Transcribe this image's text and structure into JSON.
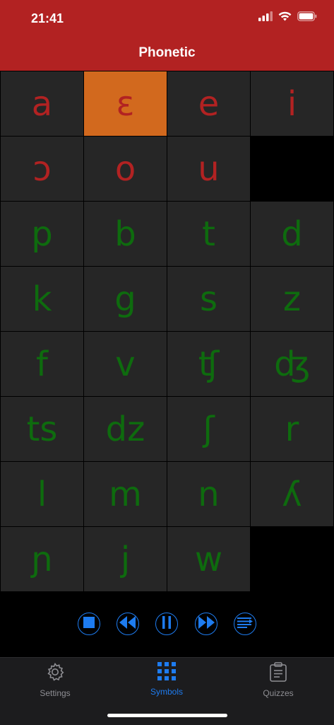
{
  "status": {
    "time": "21:41"
  },
  "nav": {
    "title": "Phonetic"
  },
  "symbols": {
    "rows": [
      [
        {
          "symbol": "a",
          "kind": "vowel",
          "selected": false
        },
        {
          "symbol": "ɛ",
          "kind": "vowel",
          "selected": true
        },
        {
          "symbol": "e",
          "kind": "vowel",
          "selected": false
        },
        {
          "symbol": "i",
          "kind": "vowel",
          "selected": false
        }
      ],
      [
        {
          "symbol": "ɔ",
          "kind": "vowel",
          "selected": false
        },
        {
          "symbol": "o",
          "kind": "vowel",
          "selected": false
        },
        {
          "symbol": "u",
          "kind": "vowel",
          "selected": false
        }
      ],
      [
        {
          "symbol": "p",
          "kind": "consonant",
          "selected": false
        },
        {
          "symbol": "b",
          "kind": "consonant",
          "selected": false
        },
        {
          "symbol": "t",
          "kind": "consonant",
          "selected": false
        },
        {
          "symbol": "d",
          "kind": "consonant",
          "selected": false
        }
      ],
      [
        {
          "symbol": "k",
          "kind": "consonant",
          "selected": false
        },
        {
          "symbol": "g",
          "kind": "consonant",
          "selected": false
        },
        {
          "symbol": "s",
          "kind": "consonant",
          "selected": false
        },
        {
          "symbol": "z",
          "kind": "consonant",
          "selected": false
        }
      ],
      [
        {
          "symbol": "f",
          "kind": "consonant",
          "selected": false
        },
        {
          "symbol": "v",
          "kind": "consonant",
          "selected": false
        },
        {
          "symbol": "ʧ",
          "kind": "consonant",
          "selected": false
        },
        {
          "symbol": "ʤ",
          "kind": "consonant",
          "selected": false
        }
      ],
      [
        {
          "symbol": "ts",
          "kind": "consonant",
          "selected": false
        },
        {
          "symbol": "dz",
          "kind": "consonant",
          "selected": false
        },
        {
          "symbol": "ʃ",
          "kind": "consonant",
          "selected": false
        },
        {
          "symbol": "r",
          "kind": "consonant",
          "selected": false
        }
      ],
      [
        {
          "symbol": "l",
          "kind": "consonant",
          "selected": false
        },
        {
          "symbol": "m",
          "kind": "consonant",
          "selected": false
        },
        {
          "symbol": "n",
          "kind": "consonant",
          "selected": false
        },
        {
          "symbol": "ʎ",
          "kind": "consonant",
          "selected": false
        }
      ],
      [
        {
          "symbol": "ɲ",
          "kind": "consonant",
          "selected": false
        },
        {
          "symbol": "j",
          "kind": "consonant",
          "selected": false
        },
        {
          "symbol": "w",
          "kind": "consonant",
          "selected": false
        }
      ]
    ]
  },
  "player": {
    "buttons": [
      {
        "name": "stop-button",
        "icon": "stop-icon"
      },
      {
        "name": "previous-button",
        "icon": "previous-icon"
      },
      {
        "name": "pause-button",
        "icon": "pause-icon"
      },
      {
        "name": "next-button",
        "icon": "next-icon"
      },
      {
        "name": "list-button",
        "icon": "list-icon"
      }
    ]
  },
  "tabbar": {
    "settings_label": "Settings",
    "symbols_label": "Symbols",
    "quizzes_label": "Quizzes",
    "active": "symbols"
  },
  "colors": {
    "header": "#B22222",
    "vowel": "#B22222",
    "consonant": "#0E6B0E",
    "selected": "#D2691E",
    "cell": "#262626",
    "accent": "#1E7CF0"
  }
}
